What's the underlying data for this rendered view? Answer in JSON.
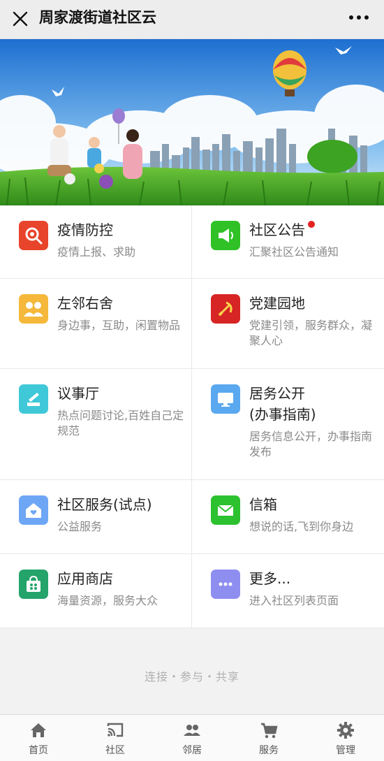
{
  "header": {
    "title": "周家渡街道社区云"
  },
  "tiles": [
    {
      "name": "疫情防控",
      "desc": "疫情上报、求助",
      "icon": "virus-search-icon",
      "color": "#e8442b",
      "badge": false
    },
    {
      "name": "社区公告",
      "desc": "汇聚社区公告通知",
      "icon": "megaphone-icon",
      "color": "#2fc125",
      "badge": true
    },
    {
      "name": "左邻右舍",
      "desc": "身边事，互助，闲置物品",
      "icon": "people-group-icon",
      "color": "#f5b83a",
      "badge": false
    },
    {
      "name": "党建园地",
      "desc": "党建引领，服务群众，凝聚人心",
      "icon": "party-emblem-icon",
      "color": "#d72424",
      "badge": false
    },
    {
      "name": "议事厅",
      "desc": "热点问题讨论,百姓自己定规范",
      "icon": "gavel-icon",
      "color": "#3fc8d8",
      "badge": false
    },
    {
      "name": "居务公开\n(办事指南)",
      "desc": "居务信息公开，办事指南发布",
      "icon": "monitor-icon",
      "color": "#5aa8f0",
      "badge": false
    },
    {
      "name": "社区服务(试点)",
      "desc": "公益服务",
      "icon": "house-heart-icon",
      "color": "#6ea6f6",
      "badge": false
    },
    {
      "name": "信箱",
      "desc": "想说的话,飞到你身边",
      "icon": "mail-icon",
      "color": "#2cc12f",
      "badge": false
    },
    {
      "name": "应用商店",
      "desc": "海量资源，服务大众",
      "icon": "store-bag-icon",
      "color": "#24a36a",
      "badge": false
    },
    {
      "name": "更多...",
      "desc": "进入社区列表页面",
      "icon": "ellipsis-icon",
      "color": "#8e8ef0",
      "badge": false
    }
  ],
  "slogan": "连接・参与・共享",
  "nav": [
    {
      "label": "首页",
      "icon": "home-icon"
    },
    {
      "label": "社区",
      "icon": "cast-icon"
    },
    {
      "label": "邻居",
      "icon": "people-icon"
    },
    {
      "label": "服务",
      "icon": "cart-icon"
    },
    {
      "label": "管理",
      "icon": "gear-icon"
    }
  ]
}
